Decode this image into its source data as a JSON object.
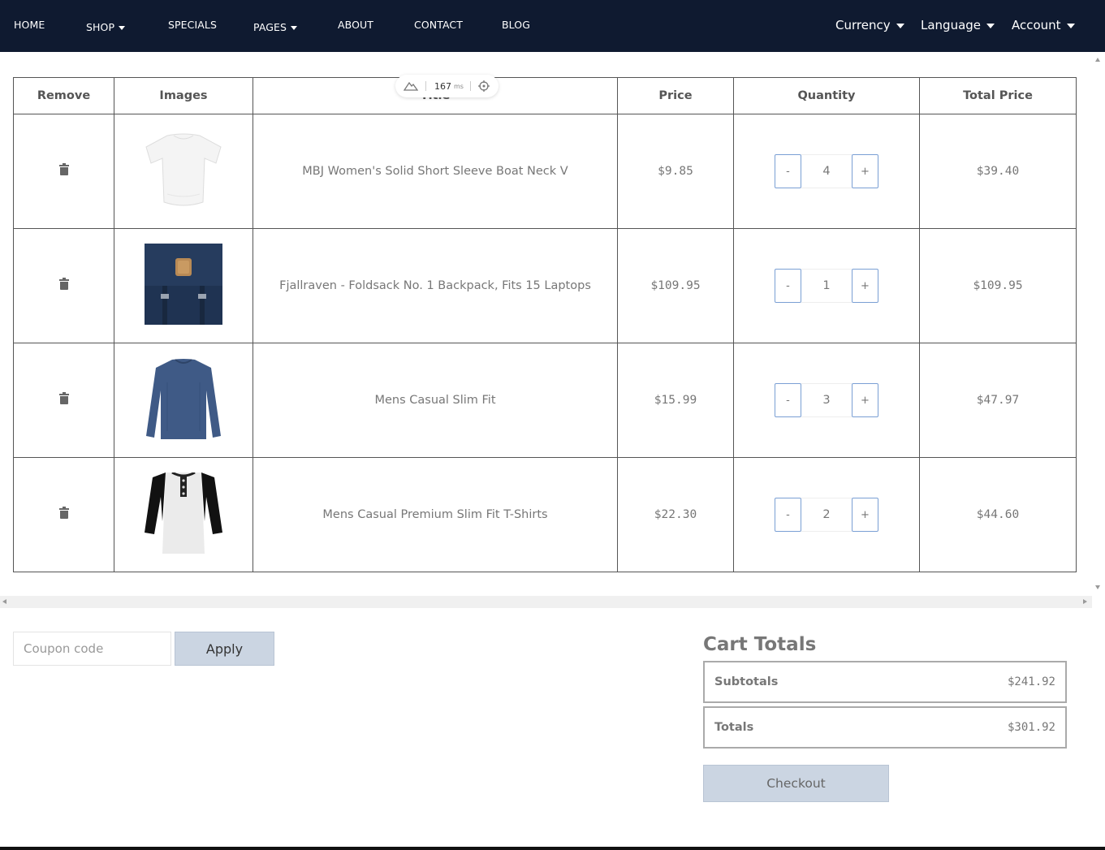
{
  "nav": {
    "items": [
      {
        "label": "HOME",
        "dropdown": false
      },
      {
        "label": "SHOP",
        "dropdown": true
      },
      {
        "label": "SPECIALS",
        "dropdown": false
      },
      {
        "label": "PAGES",
        "dropdown": true
      },
      {
        "label": "ABOUT",
        "dropdown": false
      },
      {
        "label": "CONTACT",
        "dropdown": false
      },
      {
        "label": "BLOG",
        "dropdown": false
      }
    ],
    "right": [
      {
        "label": "Currency"
      },
      {
        "label": "Language"
      },
      {
        "label": "Account"
      }
    ]
  },
  "perf_widget": {
    "value": "167",
    "unit": "ms"
  },
  "table": {
    "headers": [
      "Remove",
      "Images",
      "Title",
      "Price",
      "Quantity",
      "Total Price"
    ],
    "rows": [
      {
        "title": "MBJ Women's Solid Short Sleeve Boat Neck V",
        "price": "$9.85",
        "quantity": "4",
        "total": "$39.40",
        "image": "white-womens-top"
      },
      {
        "title": "Fjallraven - Foldsack No. 1 Backpack, Fits 15 Laptops",
        "price": "$109.95",
        "quantity": "1",
        "total": "$109.95",
        "image": "navy-backpack"
      },
      {
        "title": "Mens Casual Slim Fit",
        "price": "$15.99",
        "quantity": "3",
        "total": "$47.97",
        "image": "blue-long-sleeve-shirt"
      },
      {
        "title": "Mens Casual Premium Slim Fit T-Shirts",
        "price": "$22.30",
        "quantity": "2",
        "total": "$44.60",
        "image": "raglan-henley-shirt"
      }
    ],
    "minus_label": "-",
    "plus_label": "+"
  },
  "coupon": {
    "placeholder": "Coupon code",
    "apply_label": "Apply"
  },
  "cart_totals": {
    "title": "Cart Totals",
    "subtotal_label": "Subtotals",
    "subtotal_value": "$241.92",
    "total_label": "Totals",
    "total_value": "$301.92",
    "checkout_label": "Checkout"
  },
  "colors": {
    "navbar": "#0f1a30",
    "button_bg": "#cbd5e2",
    "qty_border": "#7a9fd4"
  }
}
